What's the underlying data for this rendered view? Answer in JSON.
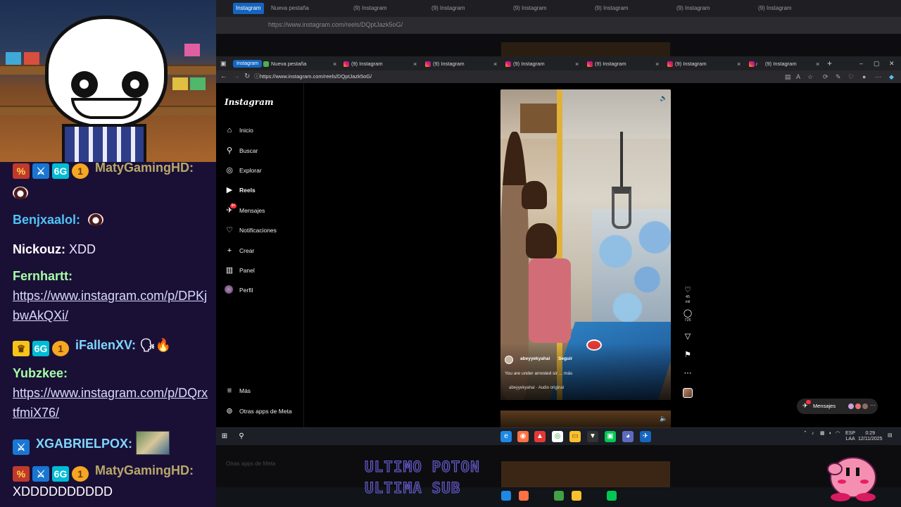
{
  "stream": {
    "chat": [
      {
        "user": "MatyGamingHD:",
        "text": "",
        "badges": [
          "mod",
          "vip",
          "6G",
          "1"
        ]
      },
      {
        "user": "",
        "text": ""
      },
      {
        "user": "Benjxaalol:",
        "text": ""
      },
      {
        "user": "Nickouz:",
        "text": "XDD"
      },
      {
        "user": "Fernhartt:",
        "text": "https://www.instagram.com/p/DPKjbwAkQXi/"
      },
      {
        "user": "iFallenXV:",
        "text": ""
      },
      {
        "user": "Yubzkee:",
        "text": "https://www.instagram.com/p/DQrxtfmiX76/"
      },
      {
        "user": "XGABRIELPOX:",
        "text": ""
      },
      {
        "user": "MatyGamingHD:",
        "text": "XDDDDDDDDDD"
      }
    ],
    "overlay_lines": [
      "ULTIMO POTON",
      "ULTIMA SUB"
    ]
  },
  "browser": {
    "tabs": [
      {
        "label": "Instagram"
      },
      {
        "label": "Nueva pestaña"
      },
      {
        "label": "(9) Instagram"
      },
      {
        "label": "(9) Instagram"
      },
      {
        "label": "(9) Instagram"
      },
      {
        "label": "(9) Instagram"
      },
      {
        "label": "(9) Instagram"
      },
      {
        "label": "(9) Instagram"
      }
    ],
    "url": "https://www.instagram.com/reels/DQptJazk5oG/",
    "bg_url": "https://www.instagram.com/reels/DQptJazk5oG/"
  },
  "instagram": {
    "logo": "Instagram",
    "nav": [
      {
        "label": "Inicio",
        "icon": "home-icon"
      },
      {
        "label": "Buscar",
        "icon": "search-icon"
      },
      {
        "label": "Explorar",
        "icon": "compass-icon"
      },
      {
        "label": "Reels",
        "icon": "reels-icon"
      },
      {
        "label": "Mensajes",
        "icon": "messenger-icon"
      },
      {
        "label": "Notificaciones",
        "icon": "heart-icon"
      },
      {
        "label": "Crear",
        "icon": "plus-icon"
      },
      {
        "label": "Panel",
        "icon": "dashboard-icon"
      },
      {
        "label": "Perfil",
        "icon": "avatar-icon"
      }
    ],
    "nav_bottom": [
      {
        "label": "Más",
        "icon": "menu-icon"
      },
      {
        "label": "Otras apps de Meta",
        "icon": "meta-icon"
      }
    ],
    "reel": {
      "username": "abeyyekyahai",
      "follow": "Seguir",
      "caption": "You are under arrested sir ... más",
      "audio": "abeyyekyahai · Audio original",
      "likes": "45 mil",
      "comments": "725"
    },
    "messages_pill": "Mensajes",
    "notif_badge": "9+"
  },
  "taskbar": {
    "lang": "ESP",
    "lang2": "LAA",
    "time": "0:29",
    "date": "12/11/2025"
  },
  "colors": {
    "chat_bg": "#1a1036",
    "accent_tab": "#1565c0",
    "notif_red": "#ff3040"
  }
}
